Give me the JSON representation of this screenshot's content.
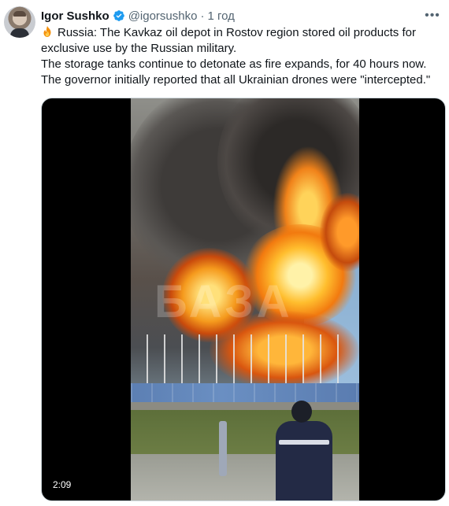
{
  "author": {
    "name": "Igor Sushko",
    "handle": "@igorsushko",
    "separator": "·",
    "time": "1 год",
    "verified": true
  },
  "tweet": {
    "emoji": "fire-icon",
    "lines": [
      "Russia: The Kavkaz oil depot in Rostov region stored oil products for",
      "exclusive use by the Russian military.",
      "The storage tanks continue to detonate as fire expands, for 40 hours now.",
      "The governor initially reported that all Ukrainian drones were \"intercepted.\""
    ]
  },
  "media": {
    "duration": "2:09",
    "watermark": "БАЗА"
  },
  "colors": {
    "text": "#0f1419",
    "secondary": "#536471",
    "verified": "#1d9bf0",
    "border": "#cfd9de"
  },
  "icons": {
    "more": "more-icon",
    "verified": "verified-badge-icon"
  }
}
